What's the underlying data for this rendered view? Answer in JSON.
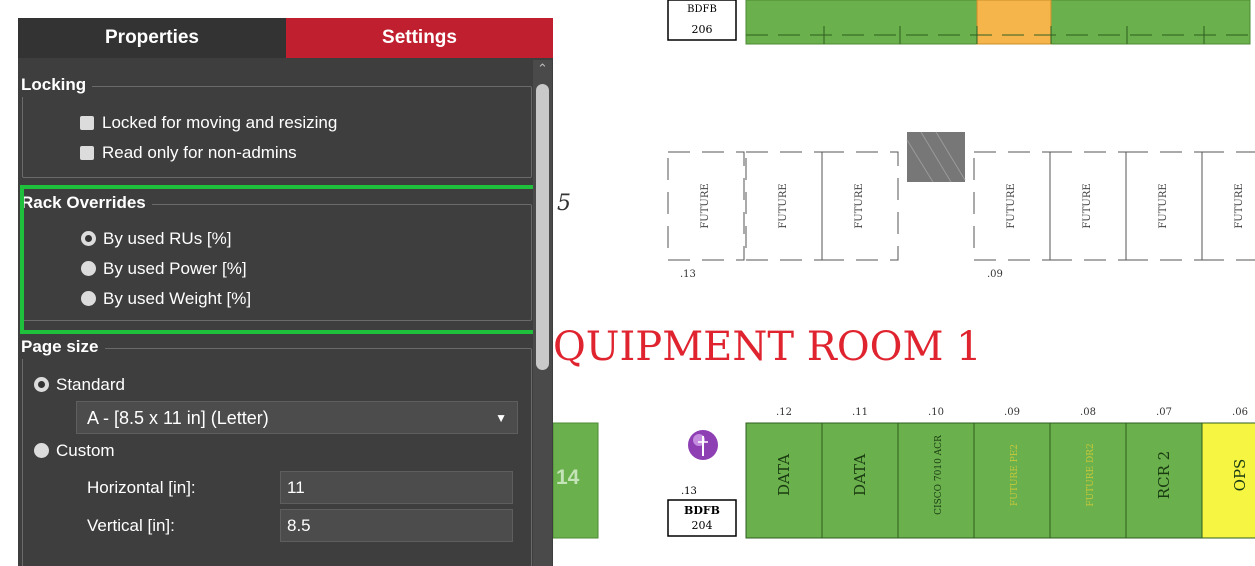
{
  "tabs": {
    "properties": "Properties",
    "settings": "Settings"
  },
  "locking": {
    "title": "Locking",
    "locked_moving": "Locked for moving and resizing",
    "read_only": "Read only for non-admins"
  },
  "rack_overrides": {
    "title": "Rack Overrides",
    "options": [
      "By used RUs [%]",
      "By used Power [%]",
      "By used Weight [%]"
    ],
    "selected": "By used RUs [%]"
  },
  "page_size": {
    "title": "Page size",
    "standard_label": "Standard",
    "standard_value": "A - [8.5 x 11 in] (Letter)",
    "custom_label": "Custom",
    "horizontal_label": "Horizontal [in]:",
    "horizontal_value": "11",
    "vertical_label": "Vertical [in]:",
    "vertical_value": "8.5"
  },
  "floor_plan": {
    "top_box_label": "206",
    "top_box_partial": "BDFB",
    "left_number": "5",
    "future_label": "FUTURE",
    "row1_tag_left": ".13",
    "row1_tag_right": ".09",
    "room_title": "QUIPMENT ROOM 1",
    "left_green_number": "14",
    "bdfb_tag": ".13",
    "bdfb_label_1": "BDFB",
    "bdfb_label_2": "204",
    "rack_numbers": [
      ".12",
      ".11",
      ".10",
      ".09",
      ".08",
      ".07",
      ".06"
    ],
    "racks": [
      {
        "label": "DATA",
        "color": "#6ab04c"
      },
      {
        "label": "DATA",
        "color": "#6ab04c"
      },
      {
        "label": "CISCO 7010 ACR",
        "color": "#6ab04c"
      },
      {
        "label": "FUTURE PE2",
        "color": "#6ab04c"
      },
      {
        "label": "FUTURE DR2",
        "color": "#6ab04c"
      },
      {
        "label": "RCR 2",
        "color": "#6ab04c"
      },
      {
        "label": "OPS",
        "color": "#f5f542"
      }
    ],
    "colors": {
      "green": "#6ab04c",
      "orange": "#f5b54a",
      "title_red": "#e0242f",
      "grey_block": "#777777"
    }
  }
}
